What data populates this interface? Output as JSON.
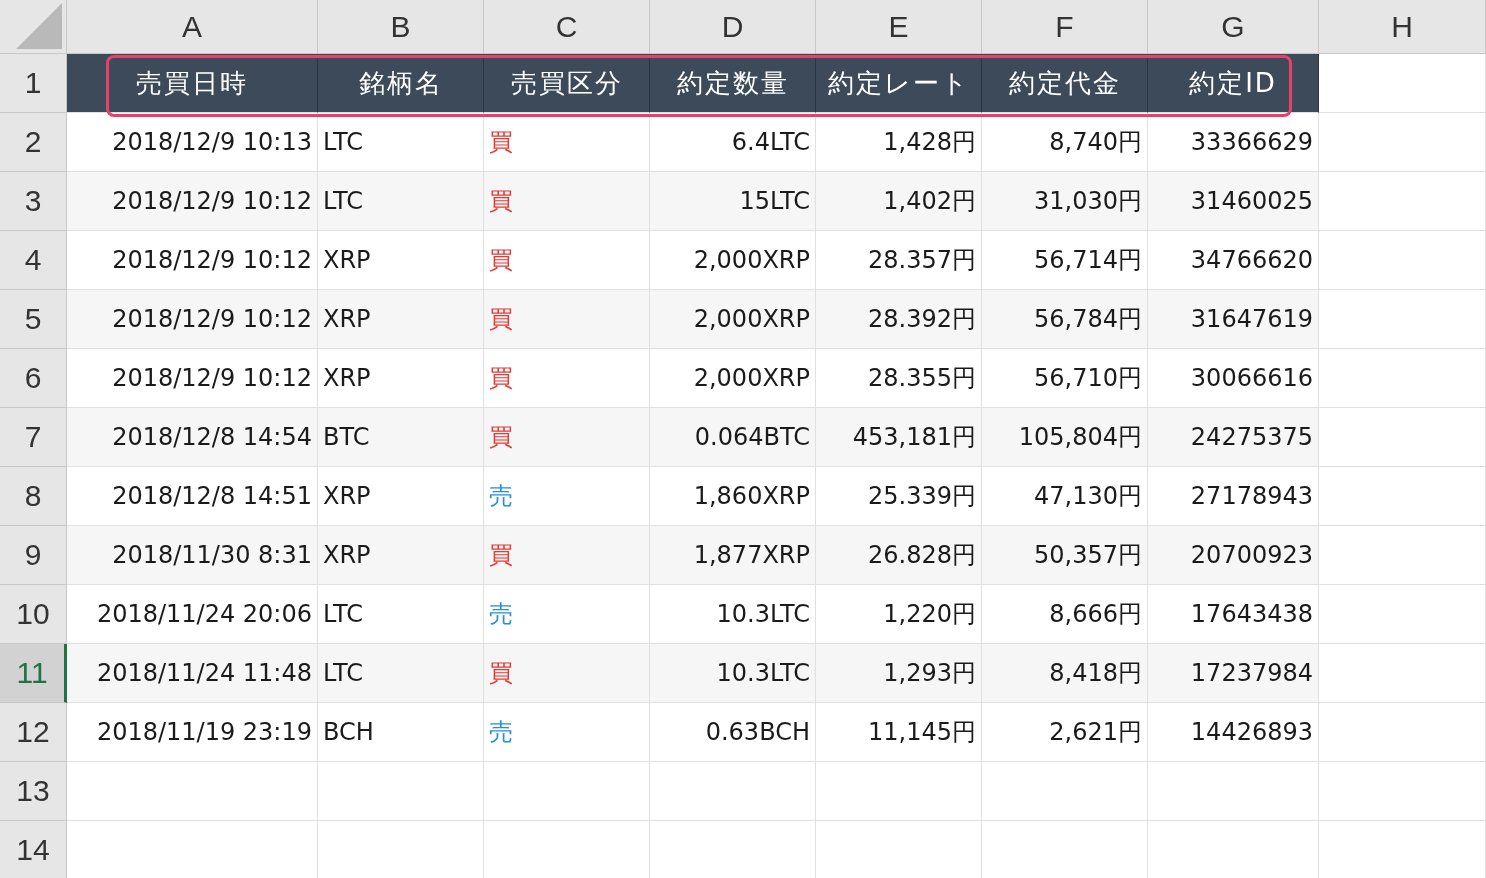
{
  "columns": [
    {
      "label": "A",
      "selected": false
    },
    {
      "label": "B",
      "selected": false
    },
    {
      "label": "C",
      "selected": false
    },
    {
      "label": "D",
      "selected": false
    },
    {
      "label": "E",
      "selected": false
    },
    {
      "label": "F",
      "selected": false
    },
    {
      "label": "G",
      "selected": false
    },
    {
      "label": "H",
      "selected": false
    }
  ],
  "row_numbers": [
    {
      "label": "1",
      "selected": false
    },
    {
      "label": "2",
      "selected": false
    },
    {
      "label": "3",
      "selected": false
    },
    {
      "label": "4",
      "selected": false
    },
    {
      "label": "5",
      "selected": false
    },
    {
      "label": "6",
      "selected": false
    },
    {
      "label": "7",
      "selected": false
    },
    {
      "label": "8",
      "selected": false
    },
    {
      "label": "9",
      "selected": false
    },
    {
      "label": "10",
      "selected": false
    },
    {
      "label": "11",
      "selected": true
    },
    {
      "label": "12",
      "selected": false
    },
    {
      "label": "13",
      "selected": false
    },
    {
      "label": "14",
      "selected": false
    }
  ],
  "header_row": [
    "売買日時",
    "銘柄名",
    "売買区分",
    "約定数量",
    "約定レート",
    "約定代金",
    "約定ID"
  ],
  "rows": [
    {
      "datetime": "2018/12/9 10:13",
      "symbol": "LTC",
      "side": {
        "text": "買",
        "color": "#e53935"
      },
      "quantity": "6.4LTC",
      "rate": "1,428円",
      "amount": "8,740円",
      "id": "33366629"
    },
    {
      "datetime": "2018/12/9 10:12",
      "symbol": "LTC",
      "side": {
        "text": "買",
        "color": "#e53935"
      },
      "quantity": "15LTC",
      "rate": "1,402円",
      "amount": "31,030円",
      "id": "31460025"
    },
    {
      "datetime": "2018/12/9 10:12",
      "symbol": "XRP",
      "side": {
        "text": "買",
        "color": "#e53935"
      },
      "quantity": "2,000XRP",
      "rate": "28.357円",
      "amount": "56,714円",
      "id": "34766620"
    },
    {
      "datetime": "2018/12/9 10:12",
      "symbol": "XRP",
      "side": {
        "text": "買",
        "color": "#e53935"
      },
      "quantity": "2,000XRP",
      "rate": "28.392円",
      "amount": "56,784円",
      "id": "31647619"
    },
    {
      "datetime": "2018/12/9 10:12",
      "symbol": "XRP",
      "side": {
        "text": "買",
        "color": "#e53935"
      },
      "quantity": "2,000XRP",
      "rate": "28.355円",
      "amount": "56,710円",
      "id": "30066616"
    },
    {
      "datetime": "2018/12/8 14:54",
      "symbol": "BTC",
      "side": {
        "text": "買",
        "color": "#e53935"
      },
      "quantity": "0.064BTC",
      "rate": "453,181円",
      "amount": "105,804円",
      "id": "24275375"
    },
    {
      "datetime": "2018/12/8 14:51",
      "symbol": "XRP",
      "side": {
        "text": "売",
        "color": "#2a8fd6"
      },
      "quantity": "1,860XRP",
      "rate": "25.339円",
      "amount": "47,130円",
      "id": "27178943"
    },
    {
      "datetime": "2018/11/30 8:31",
      "symbol": "XRP",
      "side": {
        "text": "買",
        "color": "#e53935"
      },
      "quantity": "1,877XRP",
      "rate": "26.828円",
      "amount": "50,357円",
      "id": "20700923"
    },
    {
      "datetime": "2018/11/24 20:06",
      "symbol": "LTC",
      "side": {
        "text": "売",
        "color": "#2a8fd6"
      },
      "quantity": "10.3LTC",
      "rate": "1,220円",
      "amount": "8,666円",
      "id": "17643438"
    },
    {
      "datetime": "2018/11/24 11:48",
      "symbol": "LTC",
      "side": {
        "text": "買",
        "color": "#e53935"
      },
      "quantity": "10.3LTC",
      "rate": "1,293円",
      "amount": "8,418円",
      "id": "17237984"
    },
    {
      "datetime": "2018/11/19 23:19",
      "symbol": "BCH",
      "side": {
        "text": "売",
        "color": "#2a8fd6"
      },
      "quantity": "0.63BCH",
      "rate": "11,145円",
      "amount": "2,621円",
      "id": "14426893"
    }
  ]
}
